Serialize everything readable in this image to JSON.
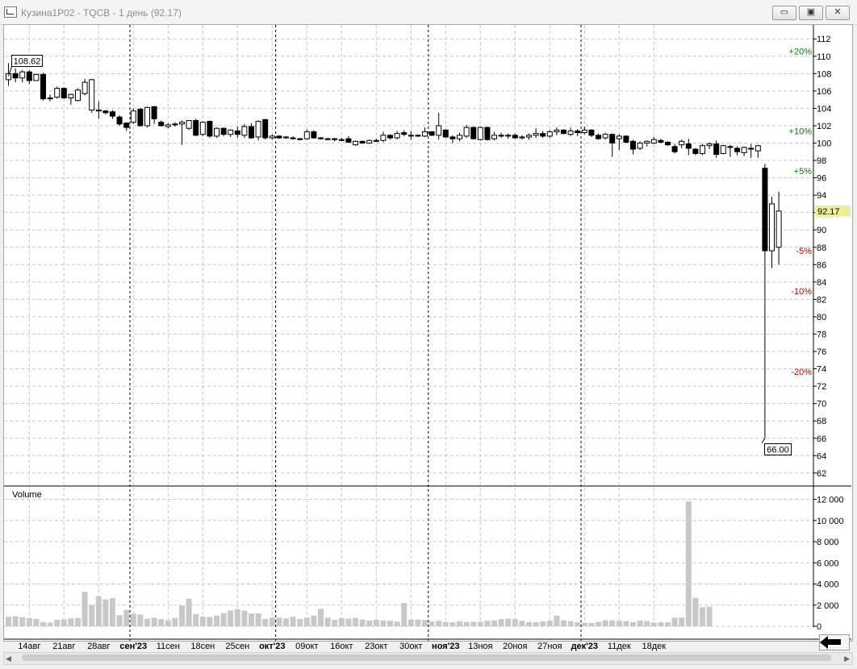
{
  "window": {
    "title": "Кузина1P02 - TQCB - 1 день (92.17)",
    "minimize_glyph": "▭",
    "restore_glyph": "▣",
    "close_glyph": "✕"
  },
  "colors": {
    "up_green": "#008000",
    "down_red": "#c00000",
    "volume_bar": "#c8c8c8",
    "price_marker_bg": "#eeee9a"
  },
  "chart_data": {
    "type": "candlestick",
    "price_axis": {
      "ylim": [
        60.5,
        113.6
      ],
      "tick_values": [
        112,
        110,
        108,
        106,
        104,
        102,
        100,
        98,
        96,
        94,
        92,
        90,
        88,
        86,
        84,
        82,
        80,
        78,
        76,
        74,
        72,
        70,
        68,
        66,
        64,
        62
      ]
    },
    "volume_axis": {
      "ylim": [
        0,
        12500
      ],
      "tick_values": [
        12000,
        10000,
        8000,
        6000,
        4000,
        2000,
        0
      ],
      "tick_labels": [
        "12 000",
        "10 000",
        "8 000",
        "6 000",
        "4 000",
        "2 000",
        "0"
      ],
      "label": "Volume"
    },
    "x_labels": [
      {
        "i": 3,
        "text": "14авг",
        "bold": false
      },
      {
        "i": 8,
        "text": "21авг",
        "bold": false
      },
      {
        "i": 13,
        "text": "28авг",
        "bold": false
      },
      {
        "i": 18,
        "text": "сен'23",
        "bold": true
      },
      {
        "i": 23,
        "text": "11сен",
        "bold": false
      },
      {
        "i": 28,
        "text": "18сен",
        "bold": false
      },
      {
        "i": 33,
        "text": "25сен",
        "bold": false
      },
      {
        "i": 38,
        "text": "окт'23",
        "bold": true
      },
      {
        "i": 43,
        "text": "09окт",
        "bold": false
      },
      {
        "i": 48,
        "text": "16окт",
        "bold": false
      },
      {
        "i": 53,
        "text": "23окт",
        "bold": false
      },
      {
        "i": 58,
        "text": "30окт",
        "bold": false
      },
      {
        "i": 63,
        "text": "ноя'23",
        "bold": true
      },
      {
        "i": 68,
        "text": "13ноя",
        "bold": false
      },
      {
        "i": 73,
        "text": "20ноя",
        "bold": false
      },
      {
        "i": 78,
        "text": "27ноя",
        "bold": false
      },
      {
        "i": 83,
        "text": "дек'23",
        "bold": true
      },
      {
        "i": 88,
        "text": "11дек",
        "bold": false
      },
      {
        "i": 93,
        "text": "18дек",
        "bold": false
      }
    ],
    "month_separators": [
      17.5,
      38.5,
      60.5,
      82.5
    ],
    "candles": [
      [
        107.3,
        109.2,
        106.6,
        108.0
      ],
      [
        108.0,
        108.6,
        107.0,
        107.5
      ],
      [
        107.5,
        108.4,
        107.0,
        108.2
      ],
      [
        108.2,
        108.4,
        106.8,
        107.2
      ],
      [
        107.2,
        108.0,
        107.2,
        107.9
      ],
      [
        107.9,
        108.1,
        104.9,
        105.1
      ],
      [
        105.1,
        105.6,
        104.8,
        105.2
      ],
      [
        105.3,
        106.5,
        105.1,
        106.3
      ],
      [
        106.3,
        106.4,
        105.1,
        105.2
      ],
      [
        105.2,
        105.7,
        104.4,
        105.6
      ],
      [
        104.9,
        106.3,
        104.8,
        106.1
      ],
      [
        105.7,
        107.4,
        105.5,
        107.0
      ],
      [
        103.8,
        107.4,
        103.5,
        107.3
      ],
      [
        103.7,
        104.8,
        102.8,
        103.8
      ],
      [
        103.7,
        103.8,
        103.3,
        103.5
      ],
      [
        103.6,
        103.8,
        102.8,
        103.1
      ],
      [
        103.0,
        103.2,
        102.0,
        102.2
      ],
      [
        102.3,
        102.4,
        101.4,
        101.8
      ],
      [
        102.4,
        104.0,
        102.2,
        103.7
      ],
      [
        103.9,
        104.0,
        101.9,
        102.0
      ],
      [
        102.0,
        104.2,
        101.8,
        104.1
      ],
      [
        104.2,
        104.2,
        102.2,
        102.8
      ],
      [
        102.4,
        102.6,
        101.9,
        102.0
      ],
      [
        101.9,
        102.3,
        101.7,
        102.1
      ],
      [
        102.2,
        102.4,
        101.9,
        102.1
      ],
      [
        102.2,
        102.6,
        99.8,
        102.4
      ],
      [
        101.7,
        102.5,
        101.5,
        102.6
      ],
      [
        102.6,
        102.8,
        100.8,
        100.9
      ],
      [
        101.0,
        102.5,
        100.8,
        102.4
      ],
      [
        102.5,
        102.6,
        100.6,
        100.8
      ],
      [
        100.8,
        101.8,
        100.6,
        101.7
      ],
      [
        101.7,
        101.8,
        100.8,
        101.0
      ],
      [
        101.0,
        101.6,
        100.7,
        101.5
      ],
      [
        101.4,
        101.9,
        100.6,
        101.0
      ],
      [
        100.9,
        102.2,
        100.6,
        101.9
      ],
      [
        101.9,
        102.3,
        100.5,
        100.6
      ],
      [
        100.7,
        102.6,
        100.3,
        102.5
      ],
      [
        102.7,
        102.8,
        100.4,
        100.6
      ],
      [
        100.6,
        101.0,
        100.4,
        100.8
      ],
      [
        100.8,
        100.9,
        100.5,
        100.6
      ],
      [
        100.6,
        100.8,
        100.5,
        100.7
      ],
      [
        100.6,
        100.8,
        100.4,
        100.5
      ],
      [
        100.5,
        100.6,
        100.3,
        100.4
      ],
      [
        100.5,
        101.6,
        100.4,
        101.3
      ],
      [
        101.3,
        101.5,
        100.5,
        100.6
      ],
      [
        100.6,
        100.7,
        100.4,
        100.5
      ],
      [
        100.5,
        100.6,
        100.3,
        100.4
      ],
      [
        100.4,
        100.6,
        100.2,
        100.5
      ],
      [
        100.4,
        100.6,
        100.2,
        100.3
      ],
      [
        100.5,
        100.8,
        100.2,
        100.1
      ],
      [
        99.8,
        100.3,
        99.7,
        100.2
      ],
      [
        100.2,
        100.3,
        99.9,
        100.0
      ],
      [
        100.0,
        100.4,
        99.9,
        100.3
      ],
      [
        100.3,
        100.5,
        100.1,
        100.2
      ],
      [
        100.3,
        101.3,
        100.1,
        100.9
      ],
      [
        100.9,
        101.0,
        100.4,
        100.6
      ],
      [
        100.6,
        101.4,
        100.4,
        101.1
      ],
      [
        101.2,
        101.5,
        100.8,
        101.0
      ],
      [
        100.8,
        101.4,
        100.4,
        100.9
      ],
      [
        100.9,
        101.0,
        100.7,
        100.8
      ],
      [
        100.8,
        101.8,
        100.7,
        101.3
      ],
      [
        101.3,
        101.4,
        100.8,
        100.9
      ],
      [
        100.9,
        103.5,
        100.4,
        102.0
      ],
      [
        101.5,
        101.6,
        100.6,
        100.7
      ],
      [
        100.7,
        100.9,
        100.0,
        100.5
      ],
      [
        100.5,
        101.2,
        100.2,
        100.9
      ],
      [
        100.8,
        102.1,
        100.6,
        101.8
      ],
      [
        101.8,
        101.9,
        100.4,
        100.5
      ],
      [
        100.4,
        101.9,
        100.3,
        101.8
      ],
      [
        101.8,
        101.9,
        100.3,
        100.4
      ],
      [
        100.5,
        101.3,
        100.3,
        100.9
      ],
      [
        100.9,
        101.2,
        100.6,
        100.8
      ],
      [
        100.8,
        101.1,
        100.5,
        100.9
      ],
      [
        100.9,
        101.1,
        100.5,
        100.6
      ],
      [
        100.6,
        100.9,
        100.4,
        100.7
      ],
      [
        100.7,
        101.1,
        100.4,
        100.9
      ],
      [
        100.9,
        101.7,
        100.6,
        101.1
      ],
      [
        101.1,
        101.4,
        100.6,
        100.8
      ],
      [
        100.8,
        101.5,
        100.6,
        101.3
      ],
      [
        101.3,
        101.8,
        100.9,
        101.5
      ],
      [
        101.5,
        101.6,
        101.0,
        101.1
      ],
      [
        101.0,
        101.8,
        100.8,
        101.4
      ],
      [
        101.4,
        101.6,
        100.8,
        101.2
      ],
      [
        101.2,
        101.9,
        101.0,
        101.5
      ],
      [
        101.5,
        101.6,
        100.7,
        100.9
      ],
      [
        100.9,
        101.1,
        100.4,
        100.5
      ],
      [
        100.6,
        101.2,
        100.4,
        101.0
      ],
      [
        101.0,
        101.1,
        98.4,
        100.0
      ],
      [
        100.5,
        101.0,
        99.2,
        100.8
      ],
      [
        100.8,
        100.9,
        100.0,
        100.1
      ],
      [
        100.2,
        100.4,
        98.7,
        99.3
      ],
      [
        99.4,
        100.2,
        99.2,
        100.0
      ],
      [
        100.0,
        100.3,
        99.6,
        100.2
      ],
      [
        100.0,
        100.7,
        99.9,
        100.4
      ],
      [
        100.3,
        100.5,
        100.0,
        100.1
      ],
      [
        100.1,
        100.2,
        99.7,
        99.8
      ],
      [
        99.6,
        99.9,
        98.8,
        99.0
      ],
      [
        99.8,
        100.4,
        99.4,
        100.2
      ],
      [
        99.9,
        100.5,
        98.6,
        99.4
      ],
      [
        99.3,
        99.4,
        98.6,
        98.8
      ],
      [
        98.8,
        99.9,
        98.6,
        99.7
      ],
      [
        99.7,
        100.1,
        99.3,
        99.9
      ],
      [
        99.9,
        100.3,
        98.3,
        98.7
      ],
      [
        98.8,
        99.8,
        98.7,
        99.7
      ],
      [
        99.6,
        99.8,
        98.4,
        99.5
      ],
      [
        99.4,
        99.6,
        98.6,
        99.0
      ],
      [
        98.9,
        99.6,
        98.5,
        99.5
      ],
      [
        99.4,
        99.9,
        98.3,
        99.3
      ],
      [
        99.1,
        99.8,
        98.3,
        99.7
      ],
      [
        97.1,
        97.6,
        66.0,
        87.6
      ],
      [
        87.6,
        93.8,
        85.6,
        93.0
      ],
      [
        88.0,
        94.4,
        86.0,
        92.17
      ]
    ],
    "volumes": [
      900,
      950,
      860,
      760,
      700,
      400,
      350,
      600,
      650,
      750,
      780,
      3250,
      2000,
      2850,
      2550,
      2650,
      1050,
      1550,
      1200,
      1100,
      720,
      800,
      680,
      560,
      780,
      1950,
      2600,
      1150,
      920,
      880,
      1020,
      1250,
      1500,
      1600,
      1480,
      1200,
      1220,
      700,
      820,
      820,
      740,
      900,
      700,
      820,
      1020,
      1650,
      820,
      620,
      780,
      720,
      790,
      640,
      540,
      610,
      550,
      520,
      440,
      2200,
      620,
      640,
      600,
      460,
      520,
      420,
      380,
      480,
      420,
      420,
      420,
      520,
      560,
      680,
      720,
      670,
      520,
      410,
      380,
      470,
      520,
      1020,
      570,
      500,
      380,
      340,
      310,
      410,
      560,
      560,
      510,
      480,
      380,
      530,
      480,
      350,
      400,
      380,
      810,
      820,
      11800,
      2700,
      1800,
      1850
    ],
    "price_marker": {
      "value": 92.17,
      "label": "92.17"
    },
    "max_label": {
      "value": 108.62,
      "label": "108.62"
    },
    "min_label": {
      "value": 66.0,
      "label": "66.00"
    },
    "pct_levels": [
      {
        "value": 110.6,
        "label": "+20%",
        "color": "#008000"
      },
      {
        "value": 101.4,
        "label": "+10%",
        "color": "#008000"
      },
      {
        "value": 96.8,
        "label": "+5%",
        "color": "#008000"
      },
      {
        "value": 87.6,
        "label": "-5%",
        "color": "#c00000"
      },
      {
        "value": 82.95,
        "label": "-10%",
        "color": "#c00000"
      },
      {
        "value": 73.7,
        "label": "-20%",
        "color": "#c00000"
      }
    ]
  }
}
